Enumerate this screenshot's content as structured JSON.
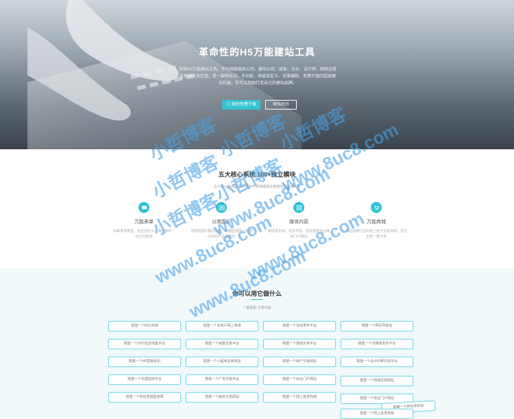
{
  "hero": {
    "title": "革命性的H5万能建站工具",
    "description": "豺狼H5万能建站工具，专为网络服务公司、建站公司、威客、站长、设计师、网络运营及营销人员打造，是一款响应式、多功能、高度自定义、无需编程、免费开源的超级建站利器，你可以用她打造自己的建站品牌。",
    "primary_button": "◎ 限时免费下载",
    "secondary_button": "体验后台"
  },
  "features_section": {
    "title": "五大核心系统 100+独立模块",
    "subtitle": "五大核心系统及100+模块可单独或组合使用达到最佳效果",
    "items": [
      {
        "title": "万能表单",
        "desc": "15种表单类型，完全自定义，满足你的一切互动需求",
        "icon": "chat-icon"
      },
      {
        "title": "分类图片",
        "desc": "漂亮的图片展示功能，海报型案例一样展示你的产品或服务",
        "icon": "image-icon"
      },
      {
        "title": "媒体内容",
        "desc": "新闻发布快、内容丰富，轻松搭建专业媒体门户网站",
        "icon": "media-icon"
      },
      {
        "title": "万能商城",
        "desc": "满足各种行业的线上线下交易商城，支付全部一键下单",
        "icon": "cart-icon"
      }
    ]
  },
  "uses_section": {
    "title": "你可以用它做什么",
    "subtitle": "一套系统 无限可能",
    "items": [
      "搭建一个B2C商城",
      "搭建一个多商户网上商城",
      "搭建一个活动发布平台",
      "搭建一个网址导航站",
      "搭建一个O2O信息收集平台",
      "搭建一个威客交易平台",
      "搭建一个游戏交易平台",
      "搭建一个自媒体发布平台",
      "搭建一个H5营销单页",
      "搭建一个小程序应用商店",
      "搭建一个房产交易网站",
      "搭建一个设计印刷交易平台",
      "搭建一个代理招商平台",
      "搭建一个广告交易平台",
      "搭建一个综合门户网站",
      "搭建一个商城交易网站",
      "搭建一个响应营销型官网",
      "搭建一个服务交易网站",
      "搭建一个网上批发商城",
      "搭建一个综合门户网站",
      "搭建一个网址导航站",
      "搭建一个网上批发商城"
    ]
  },
  "watermark": {
    "cn": "小哲博客",
    "url": "www.8uc8.com"
  },
  "colors": {
    "accent": "#35c3d3",
    "uses_background": "#f2f9fb",
    "watermark": "#4aa2e6"
  }
}
